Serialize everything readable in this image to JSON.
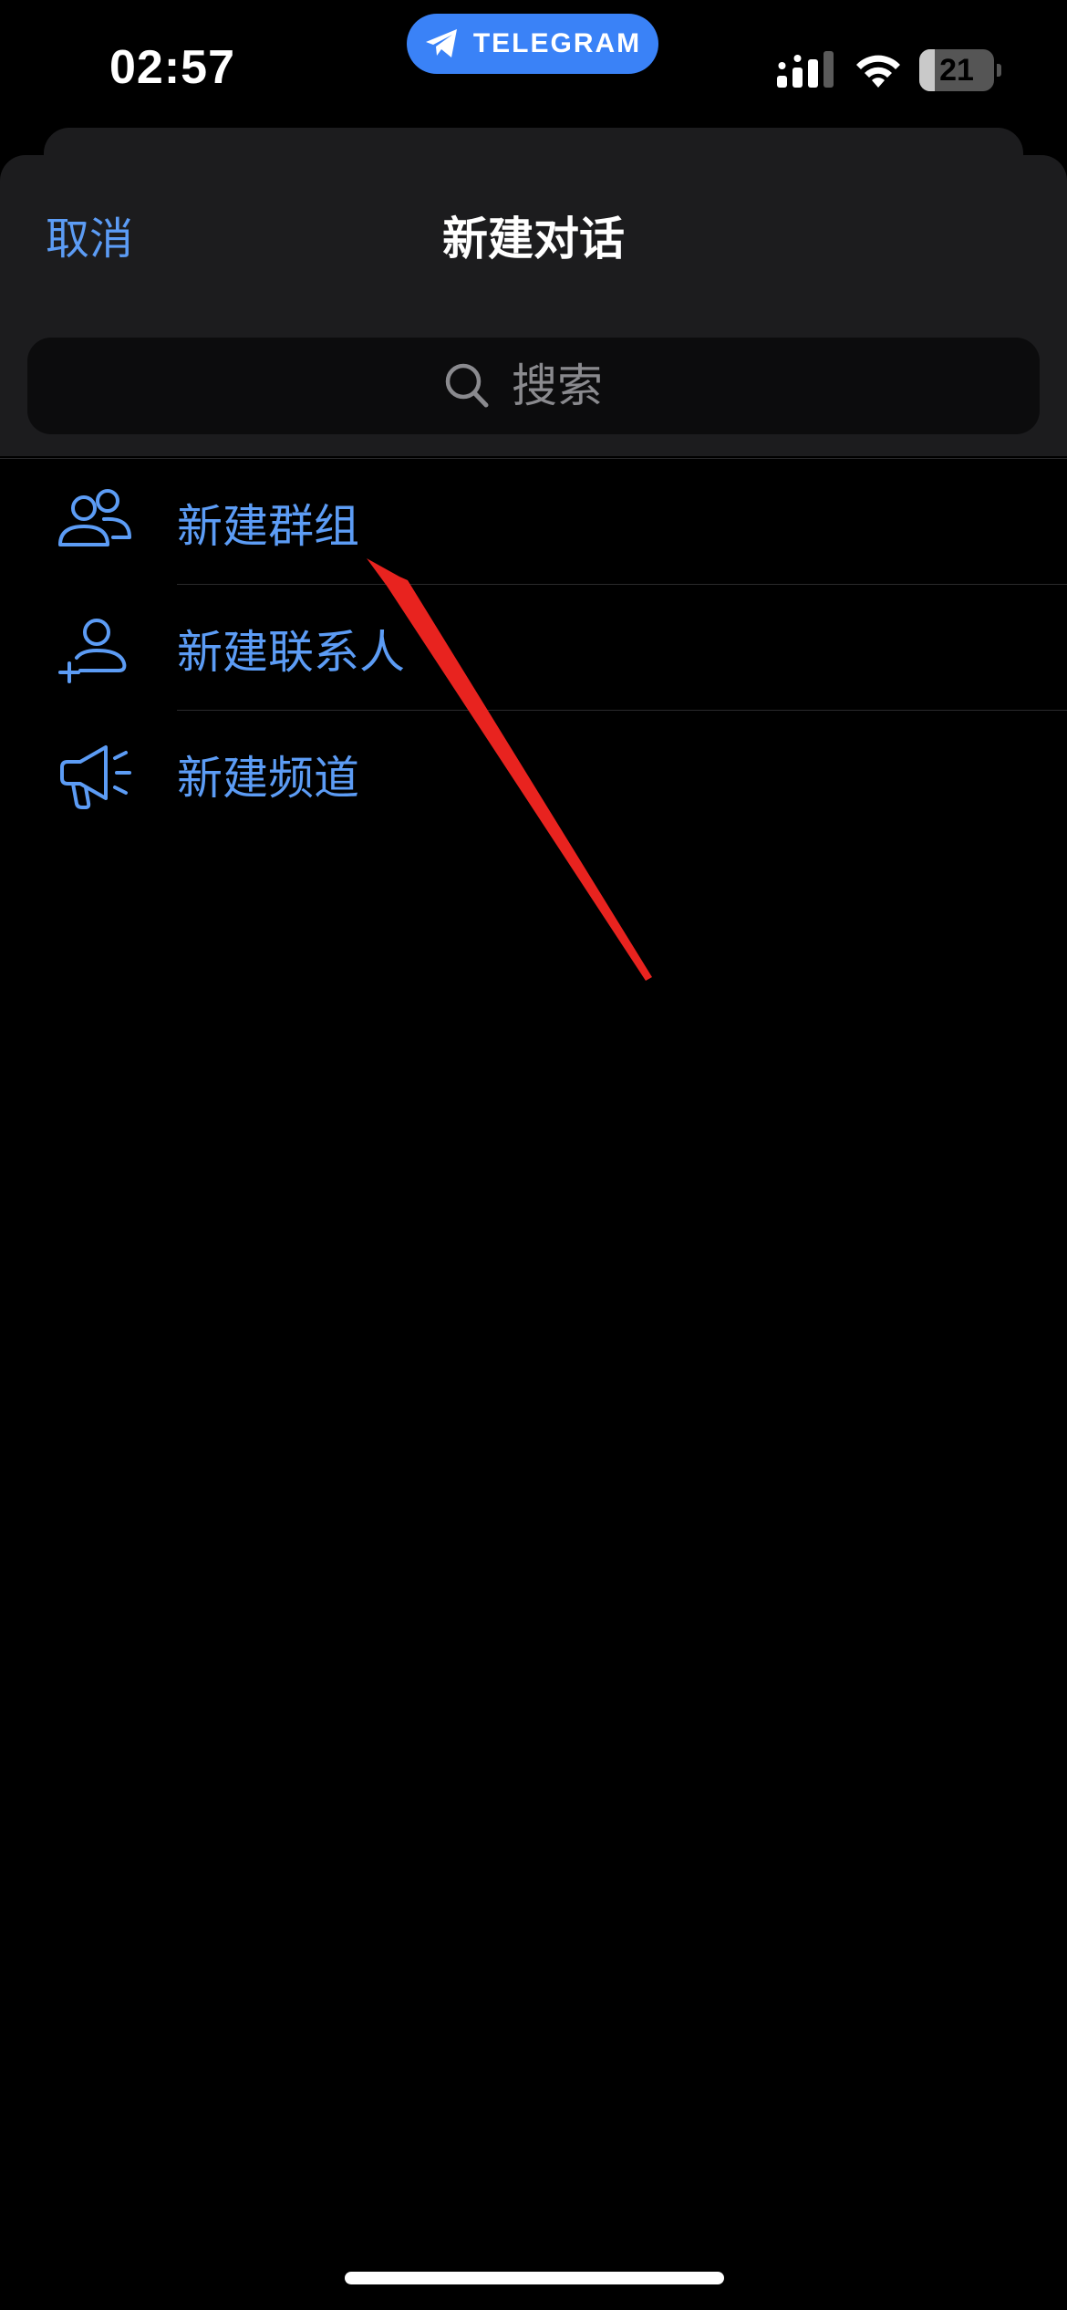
{
  "status_bar": {
    "time": "02:57",
    "app_pill_label": "TELEGRAM",
    "battery_text": "21",
    "battery_level": 0.21
  },
  "sheet": {
    "cancel_label": "取消",
    "title": "新建对话",
    "search_placeholder": "搜索"
  },
  "menu": {
    "items": [
      {
        "label": "新建群组",
        "icon": "group-icon"
      },
      {
        "label": "新建联系人",
        "icon": "add-contact-icon"
      },
      {
        "label": "新建频道",
        "icon": "megaphone-icon"
      }
    ]
  },
  "colors": {
    "accent": "#5c9cf5",
    "pill": "#3a82f7",
    "sheet_bg": "#1c1c1e",
    "annotation": "#e8231f"
  }
}
